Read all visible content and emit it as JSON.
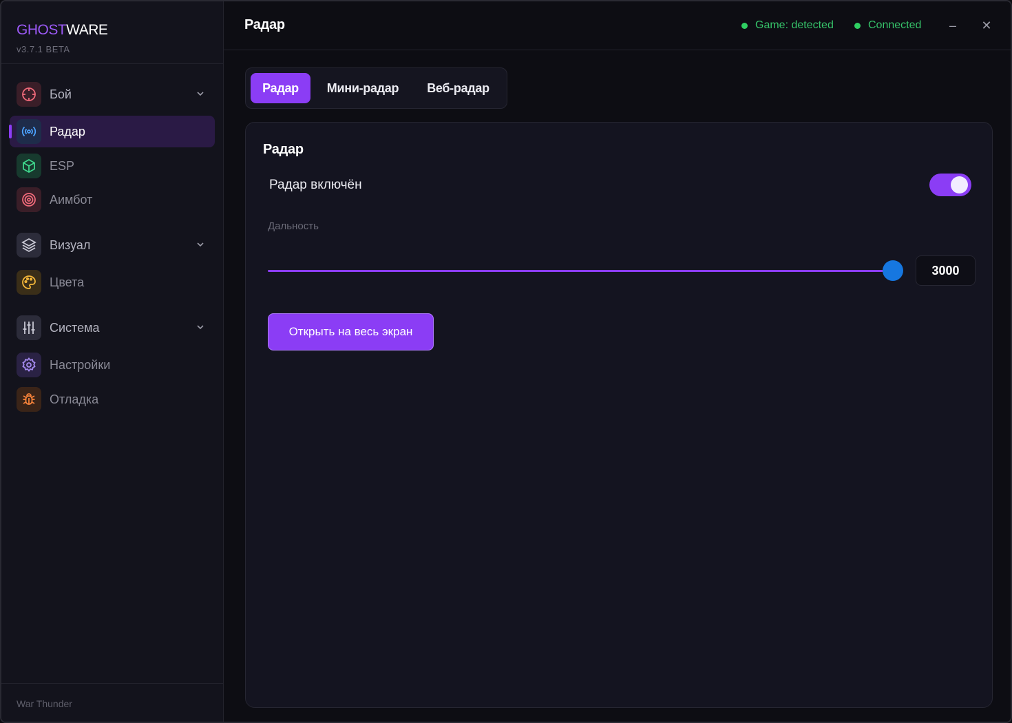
{
  "app": {
    "logo_part1": "GHOST",
    "logo_part2": "WARE",
    "version": "v3.7.1 BETA"
  },
  "sidebar": {
    "items": [
      {
        "label": "Бой",
        "icon": "crosshair-icon",
        "group": true
      },
      {
        "label": "Радар",
        "icon": "radar-broadcast-icon",
        "active": true
      },
      {
        "label": "ESP",
        "icon": "cube-icon"
      },
      {
        "label": "Аимбот",
        "icon": "target-icon"
      },
      {
        "label": "Визуал",
        "icon": "layers-icon",
        "group": true
      },
      {
        "label": "Цвета",
        "icon": "palette-icon"
      },
      {
        "label": "Система",
        "icon": "sliders-icon",
        "group": true
      },
      {
        "label": "Настройки",
        "icon": "gear-icon"
      },
      {
        "label": "Отладка",
        "icon": "bug-icon"
      }
    ],
    "footer": "War Thunder"
  },
  "header": {
    "title": "Радар",
    "status_game": "Game: detected",
    "status_connection": "Connected",
    "minimize": "–",
    "close": "✕"
  },
  "tabs": [
    {
      "label": "Радар",
      "active": true
    },
    {
      "label": "Мини-радар"
    },
    {
      "label": "Веб-радар"
    }
  ],
  "panel": {
    "title": "Радар",
    "toggle_label": "Радар включён",
    "toggle_on": true,
    "range_label": "Дальность",
    "range_value": "3000",
    "fullscreen_button": "Открыть на весь экран"
  },
  "colors": {
    "accent": "#8b3df5",
    "status_green": "#2fcf62",
    "slider_thumb": "#1677e0"
  }
}
